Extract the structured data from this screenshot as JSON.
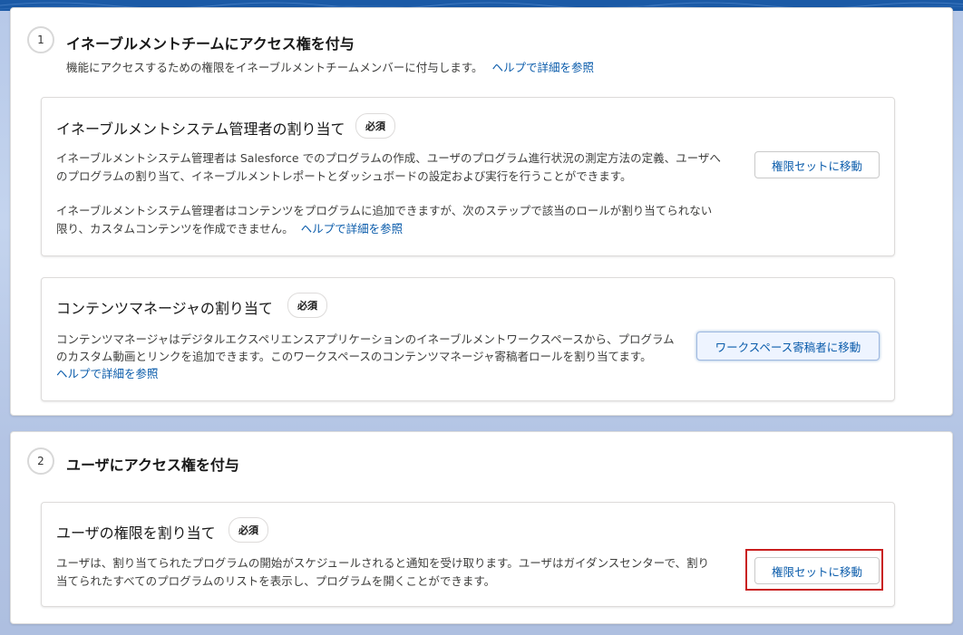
{
  "steps": [
    {
      "number": "1",
      "title": "イネーブルメントチームにアクセス権を付与",
      "description": "機能にアクセスするための権限をイネーブルメントチームメンバーに付与します。",
      "help_link": "ヘルプで詳細を参照",
      "cards": [
        {
          "title": "イネーブルメントシステム管理者の割り当て",
          "badge": "必須",
          "para1_line1": "イネーブルメントシステム管理者は Salesforce でのプログラムの作成、ユーザのプログラム進行状況の測定方法の定義、ユーザへ",
          "para1_line2": "のプログラムの割り当て、イネーブルメントレポートとダッシュボードの設定および実行を行うことができます。",
          "para2_line1": "イネーブルメントシステム管理者はコンテンツをプログラムに追加できますが、次のステップで該当のロールが割り当てられない",
          "para2_line2": "限り、カスタムコンテンツを作成できません。",
          "help_link": "ヘルプで詳細を参照",
          "button": "権限セットに移動"
        },
        {
          "title": "コンテンツマネージャの割り当て",
          "badge": "必須",
          "line1": "コンテンツマネージャはデジタルエクスペリエンスアプリケーションのイネーブルメントワークスペースから、プログラム",
          "line2": "のカスタム動画とリンクを追加できます。このワークスペースのコンテンツマネージャ寄稿者ロールを割り当てます。",
          "help_link": "ヘルプで詳細を参照",
          "button": "ワークスペース寄稿者に移動"
        }
      ]
    },
    {
      "number": "2",
      "title": "ユーザにアクセス権を付与",
      "cards": [
        {
          "title": "ユーザの権限を割り当て",
          "badge": "必須",
          "line1": "ユーザは、割り当てられたプログラムの開始がスケジュールされると通知を受け取ります。ユーザはガイダンスセンターで、割り",
          "line2": "当てられたすべてのプログラムのリストを表示し、プログラムを開くことができます。",
          "button": "権限セットに移動"
        }
      ]
    }
  ],
  "colors": {
    "link": "#0b5cab",
    "highlight": "#c91e1e",
    "header_band": "#1b5aa6"
  }
}
